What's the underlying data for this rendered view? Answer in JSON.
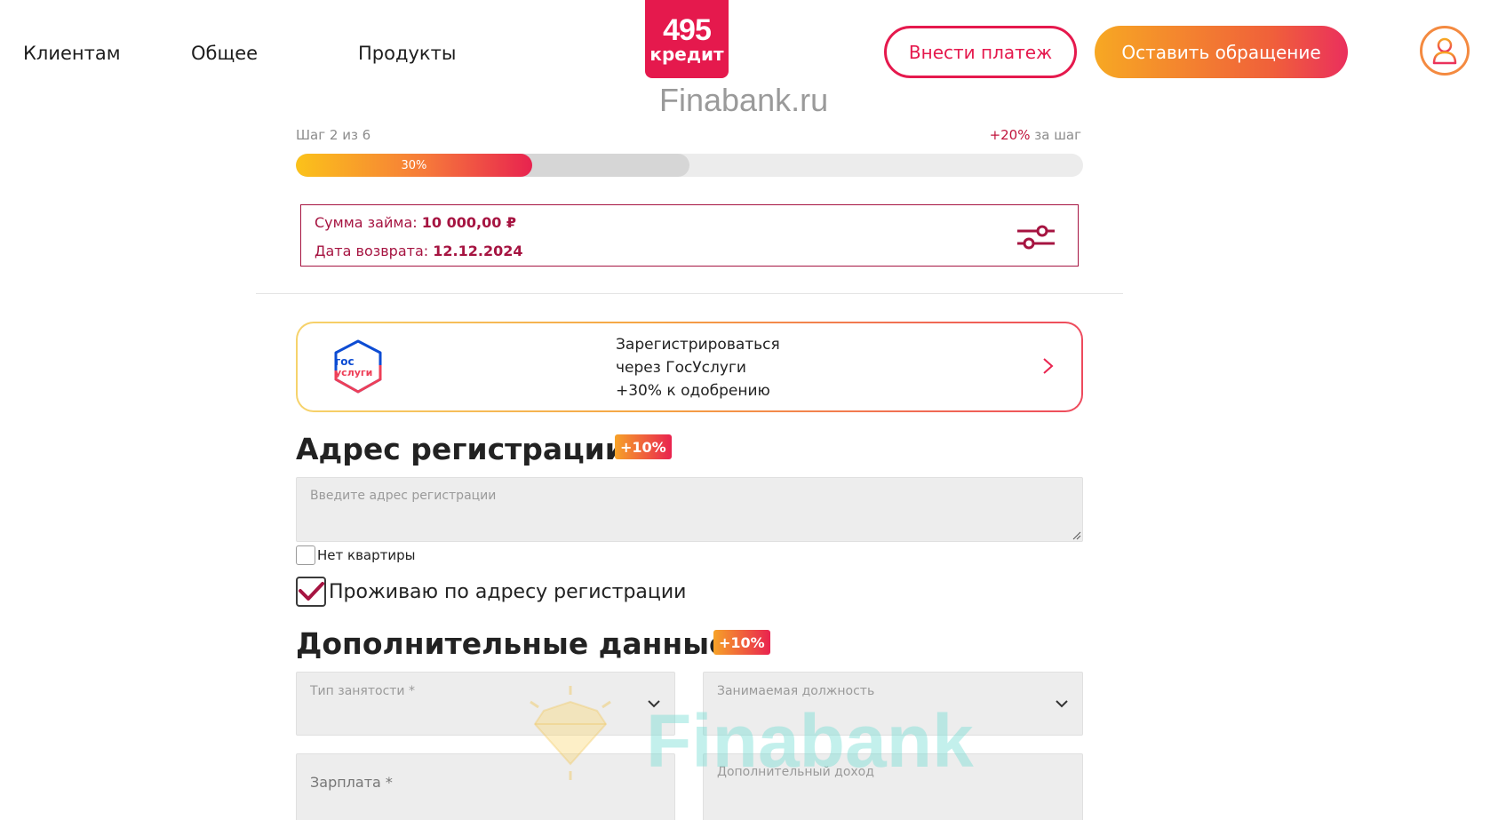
{
  "nav": {
    "items": [
      {
        "label": "Клиентам"
      },
      {
        "label": "Общее"
      },
      {
        "label": "Продукты"
      }
    ]
  },
  "logo": {
    "number": "495",
    "word": "кредит",
    "icon": "logo-495-kredit",
    "color": "#e5194d"
  },
  "header": {
    "pay_button": "Внести платеж",
    "appeal_button": "Оставить обращение",
    "profile_icon": "user-icon",
    "accent": "#e5194d",
    "gradient": [
      "#f7a823",
      "#ea2f5d"
    ]
  },
  "watermark_top": "Finabank.ru",
  "progress": {
    "step_text": "Шаг 2 из 6",
    "bonus_value": "+20%",
    "bonus_suffix": "за шаг",
    "percent": 30,
    "percent_label": "30%",
    "next_percent": 50
  },
  "loan": {
    "amount_label": "Сумма займа:",
    "amount_value": "10 000,00 ₽",
    "date_label": "Дата возврата:",
    "date_value": "12.12.2024",
    "settings_icon": "sliders-icon"
  },
  "gosuslugi": {
    "logo_text_1": "гос",
    "logo_text_2": "услуги",
    "line1": "Зарегистрироваться",
    "line2": "через ГосУслуги",
    "line3": "+30% к одобрению",
    "arrow_icon": "arrow-right-icon"
  },
  "address": {
    "title": "Адрес регистрации",
    "badge": "+10%",
    "placeholder": "Введите адрес регистрации",
    "no_apartment_label": "Нет квартиры",
    "no_apartment_checked": false,
    "live_at_reg_label": "Проживаю по адресу регистрации",
    "live_at_reg_checked": true
  },
  "extra": {
    "title": "Дополнительные данные",
    "badge": "+10%",
    "employment_label": "Тип занятости *",
    "position_label": "Занимаемая должность",
    "salary_label": "Зарплата *",
    "extra_income_label": "Дополнительный доход"
  },
  "watermark_bottom": "Finabank"
}
